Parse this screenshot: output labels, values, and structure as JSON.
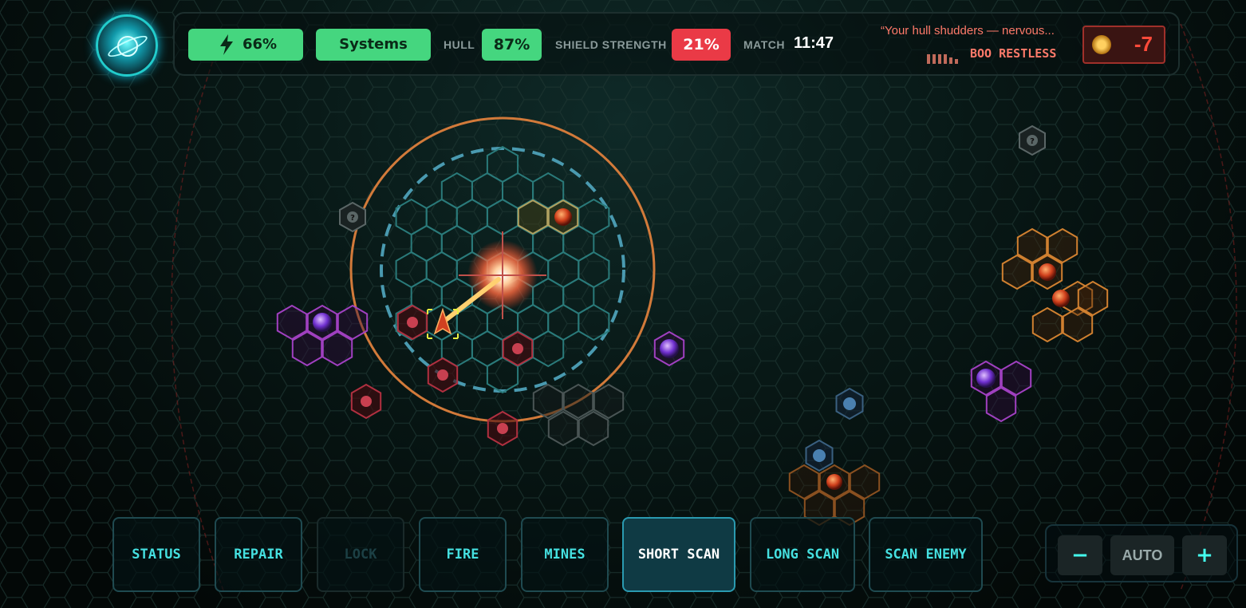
{
  "hud": {
    "energy": "66%",
    "systems_label": "Systems",
    "hull_label": "HULL",
    "hull_value": "87%",
    "shield_label": "SHIELD STRENGTH",
    "shield_value": "21%",
    "match_label": "MATCH",
    "match_time": "11:47",
    "quote": "“Your hull shudders — nervous...",
    "mood": "BOO RESTLESS",
    "score": "-7"
  },
  "colors": {
    "accent": "#45e0e0",
    "good": "#45d67f",
    "danger": "#ea3a46",
    "enemy": "#e8843a",
    "anomaly": "#b050d0"
  },
  "actions": [
    {
      "label": "STATUS",
      "state": "normal"
    },
    {
      "label": "REPAIR",
      "state": "normal"
    },
    {
      "label": "LOCK",
      "state": "disabled"
    },
    {
      "label": "FIRE",
      "state": "normal"
    },
    {
      "label": "MINES",
      "state": "normal"
    },
    {
      "label": "SHORT SCAN",
      "state": "active"
    },
    {
      "label": "LONG SCAN",
      "state": "normal"
    },
    {
      "label": "SCAN ENEMY",
      "state": "normal"
    }
  ],
  "zoom": {
    "minus": "−",
    "mode": "AUTO",
    "plus": "+"
  },
  "icons": {
    "unknown": "?",
    "energy": "lightning-icon"
  }
}
